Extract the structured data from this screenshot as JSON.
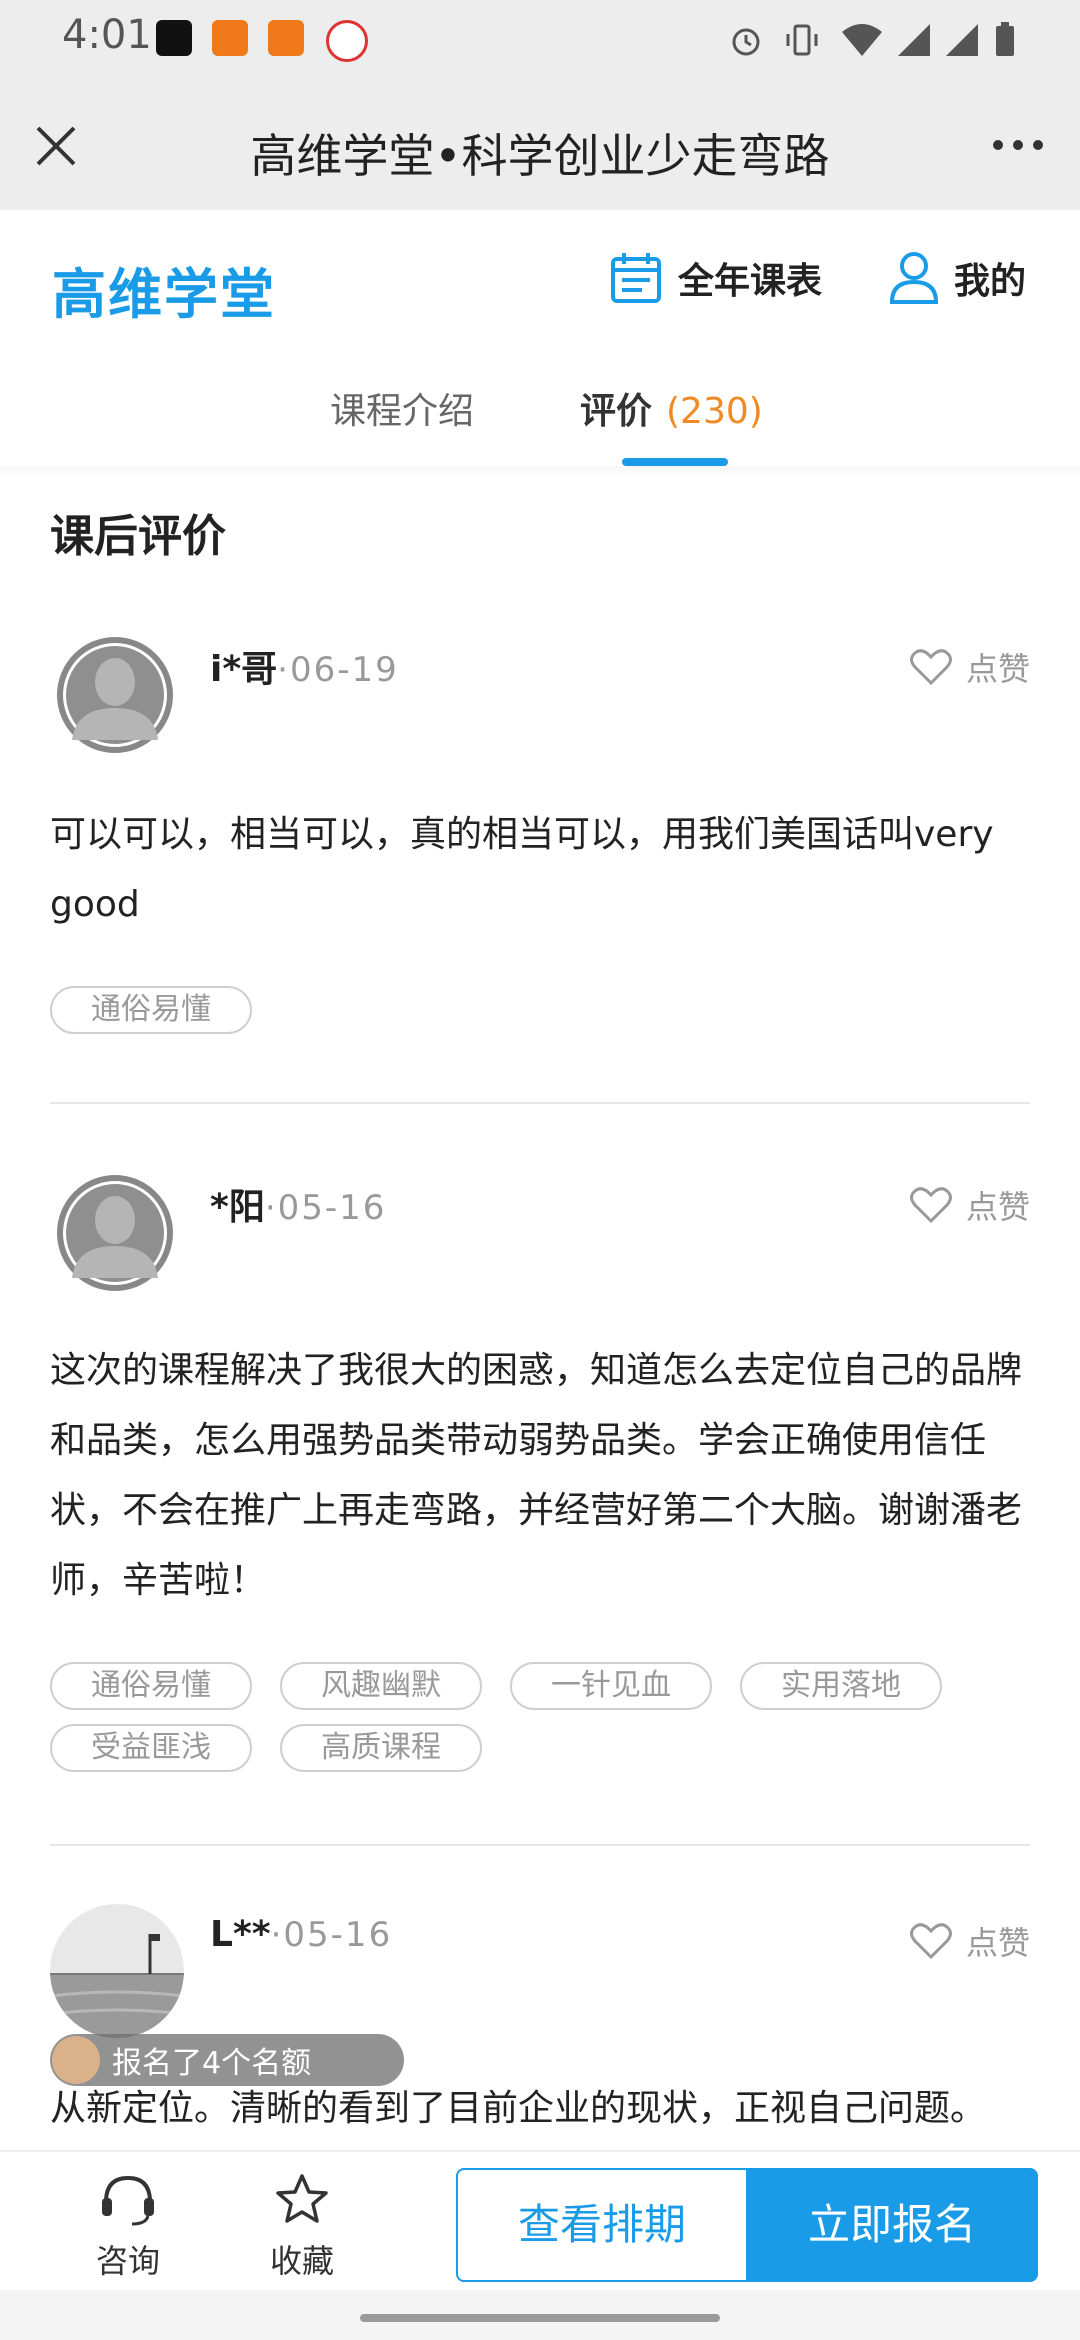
{
  "status_bar": {
    "time": "4:01"
  },
  "nav": {
    "title": "高维学堂•科学创业少走弯路"
  },
  "header": {
    "logo": "高维学堂",
    "schedule_label": "全年课表",
    "mine_label": "我的"
  },
  "tabs": [
    {
      "label": "课程介绍"
    },
    {
      "label": "评价",
      "count": "(230)"
    }
  ],
  "section_title": "课后评价",
  "like_label": "点赞",
  "reviews": [
    {
      "name": "i*哥",
      "date": "·06-19",
      "text": "可以可以，相当可以，真的相当可以，用我们美国话叫very good",
      "tags": [
        "通俗易懂"
      ]
    },
    {
      "name": "*阳",
      "date": "·05-16",
      "text": "这次的课程解决了我很大的困惑，知道怎么去定位自己的品牌和品类，怎么用强势品类带动弱势品类。学会正确使用信任状，不会在推广上再走弯路，并经营好第二个大脑。谢谢潘老师，辛苦啦！",
      "tags": [
        "通俗易懂",
        "风趣幽默",
        "一针见血",
        "实用落地",
        "受益匪浅",
        "高质课程"
      ]
    },
    {
      "name": "L**",
      "date": "·05-16",
      "text": "从新定位。清晰的看到了目前企业的现状，正视自己问题。"
    }
  ],
  "enroll_badge": "报名了4个名额",
  "bottom": {
    "consult_label": "咨询",
    "favorite_label": "收藏",
    "schedule_button": "查看排期",
    "signup_button": "立即报名"
  },
  "colors": {
    "accent": "#1a9be8",
    "count": "#f08a24"
  }
}
